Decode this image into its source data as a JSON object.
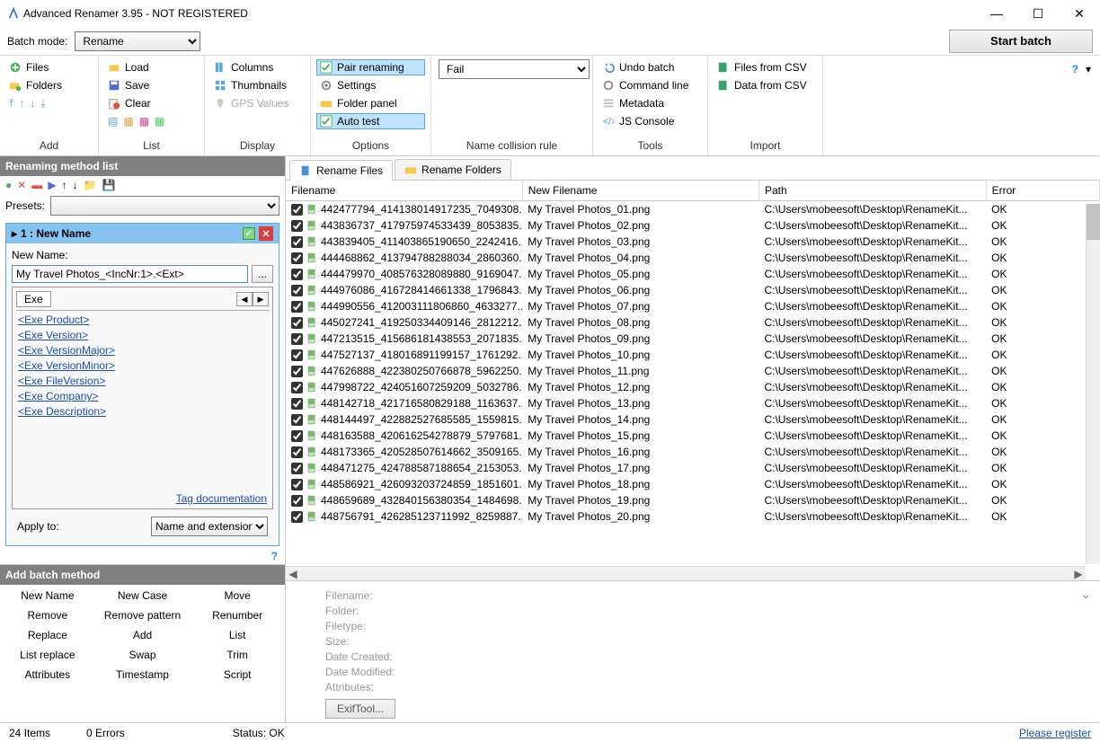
{
  "window": {
    "title": "Advanced Renamer 3.95 - NOT REGISTERED"
  },
  "winbtns": {
    "min": "—",
    "max": "☐",
    "close": "✕"
  },
  "top": {
    "batch_mode_label": "Batch mode:",
    "batch_mode_value": "Rename",
    "start": "Start batch",
    "help": "?",
    "chev": "▾"
  },
  "ribbon": {
    "add": {
      "items": [
        "Files",
        "Folders"
      ],
      "smallrow": [
        "⇡",
        "↑",
        "↓",
        "⇣"
      ],
      "label": "Add"
    },
    "list": {
      "items": [
        "Load",
        "Save",
        "Clear"
      ],
      "smallrow": [
        "▦",
        "▦",
        "▦",
        "▦"
      ],
      "label": "List"
    },
    "display": {
      "items": [
        "Columns",
        "Thumbnails",
        "GPS Values"
      ],
      "label": "Display"
    },
    "options": {
      "items": [
        "Pair renaming",
        "Settings",
        "Folder panel",
        "Auto test"
      ],
      "label": "Options"
    },
    "collision": {
      "value": "Fail",
      "label": "Name collision rule"
    },
    "tools": {
      "items": [
        "Undo batch",
        "Command line",
        "Metadata",
        "JS Console"
      ],
      "label": "Tools"
    },
    "import": {
      "items": [
        "Files from CSV",
        "Data from CSV"
      ],
      "label": "Import"
    }
  },
  "left": {
    "header": "Renaming method list",
    "presets_label": "Presets:",
    "method": {
      "title": "1 : New Name",
      "newname_label": "New Name:",
      "pattern": "My Travel Photos_<IncNr:1>.<Ext>",
      "tagtab": "Exe",
      "tags": [
        "<Exe Product>",
        "<Exe Version>",
        "<Exe VersionMajor>",
        "<Exe VersionMinor>",
        "<Exe FileVersion>",
        "<Exe Company>",
        "<Exe Description>"
      ],
      "tagdoc": "Tag documentation",
      "apply_label": "Apply to:",
      "apply_value": "Name and extension"
    },
    "addbatch": {
      "header": "Add batch method",
      "items": [
        "New Name",
        "New Case",
        "Move",
        "Remove",
        "Remove pattern",
        "Renumber",
        "Replace",
        "Add",
        "List",
        "List replace",
        "Swap",
        "Trim",
        "Attributes",
        "Timestamp",
        "Script"
      ]
    }
  },
  "tabs": {
    "files": "Rename Files",
    "folders": "Rename Folders"
  },
  "columns": {
    "fn": "Filename",
    "nfn": "New Filename",
    "path": "Path",
    "err": "Error"
  },
  "rows": [
    {
      "fn": "442477794_414138014917235_7049308...",
      "nfn": "My Travel Photos_01.png",
      "path": "C:\\Users\\mobeesoft\\Desktop\\RenameKit...",
      "err": "OK"
    },
    {
      "fn": "443836737_417975974533439_8053835...",
      "nfn": "My Travel Photos_02.png",
      "path": "C:\\Users\\mobeesoft\\Desktop\\RenameKit...",
      "err": "OK"
    },
    {
      "fn": "443839405_411403865190650_2242416...",
      "nfn": "My Travel Photos_03.png",
      "path": "C:\\Users\\mobeesoft\\Desktop\\RenameKit...",
      "err": "OK"
    },
    {
      "fn": "444468862_413794788288034_2860360...",
      "nfn": "My Travel Photos_04.png",
      "path": "C:\\Users\\mobeesoft\\Desktop\\RenameKit...",
      "err": "OK"
    },
    {
      "fn": "444479970_408576328089880_9169047...",
      "nfn": "My Travel Photos_05.png",
      "path": "C:\\Users\\mobeesoft\\Desktop\\RenameKit...",
      "err": "OK"
    },
    {
      "fn": "444976086_416728414661338_1796843...",
      "nfn": "My Travel Photos_06.png",
      "path": "C:\\Users\\mobeesoft\\Desktop\\RenameKit...",
      "err": "OK"
    },
    {
      "fn": "444990556_412003111806860_4633277...",
      "nfn": "My Travel Photos_07.png",
      "path": "C:\\Users\\mobeesoft\\Desktop\\RenameKit...",
      "err": "OK"
    },
    {
      "fn": "445027241_419250334409146_2812212...",
      "nfn": "My Travel Photos_08.png",
      "path": "C:\\Users\\mobeesoft\\Desktop\\RenameKit...",
      "err": "OK"
    },
    {
      "fn": "447213515_415686181438553_2071835...",
      "nfn": "My Travel Photos_09.png",
      "path": "C:\\Users\\mobeesoft\\Desktop\\RenameKit...",
      "err": "OK"
    },
    {
      "fn": "447527137_418016891199157_1761292...",
      "nfn": "My Travel Photos_10.png",
      "path": "C:\\Users\\mobeesoft\\Desktop\\RenameKit...",
      "err": "OK"
    },
    {
      "fn": "447626888_422380250766878_5962250...",
      "nfn": "My Travel Photos_11.png",
      "path": "C:\\Users\\mobeesoft\\Desktop\\RenameKit...",
      "err": "OK"
    },
    {
      "fn": "447998722_424051607259209_5032786...",
      "nfn": "My Travel Photos_12.png",
      "path": "C:\\Users\\mobeesoft\\Desktop\\RenameKit...",
      "err": "OK"
    },
    {
      "fn": "448142718_421716580829188_1163637...",
      "nfn": "My Travel Photos_13.png",
      "path": "C:\\Users\\mobeesoft\\Desktop\\RenameKit...",
      "err": "OK"
    },
    {
      "fn": "448144497_422882527685585_1559815...",
      "nfn": "My Travel Photos_14.png",
      "path": "C:\\Users\\mobeesoft\\Desktop\\RenameKit...",
      "err": "OK"
    },
    {
      "fn": "448163588_420616254278879_5797681...",
      "nfn": "My Travel Photos_15.png",
      "path": "C:\\Users\\mobeesoft\\Desktop\\RenameKit...",
      "err": "OK"
    },
    {
      "fn": "448173365_420528507614662_3509165...",
      "nfn": "My Travel Photos_16.png",
      "path": "C:\\Users\\mobeesoft\\Desktop\\RenameKit...",
      "err": "OK"
    },
    {
      "fn": "448471275_424788587188654_2153053...",
      "nfn": "My Travel Photos_17.png",
      "path": "C:\\Users\\mobeesoft\\Desktop\\RenameKit...",
      "err": "OK"
    },
    {
      "fn": "448586921_426093203724859_1851601...",
      "nfn": "My Travel Photos_18.png",
      "path": "C:\\Users\\mobeesoft\\Desktop\\RenameKit...",
      "err": "OK"
    },
    {
      "fn": "448659689_432840156380354_1484698...",
      "nfn": "My Travel Photos_19.png",
      "path": "C:\\Users\\mobeesoft\\Desktop\\RenameKit...",
      "err": "OK"
    },
    {
      "fn": "448756791_426285123711992_8259887...",
      "nfn": "My Travel Photos_20.png",
      "path": "C:\\Users\\mobeesoft\\Desktop\\RenameKit...",
      "err": "OK"
    }
  ],
  "detail": {
    "labels": [
      "Filename:",
      "Folder:",
      "Filetype:",
      "Size:",
      "Date Created:",
      "Date Modified:",
      "Attributes:"
    ],
    "exif": "ExifTool..."
  },
  "status": {
    "items": "24 Items",
    "errors": "0 Errors",
    "status": "Status: OK",
    "register": "Please register"
  }
}
